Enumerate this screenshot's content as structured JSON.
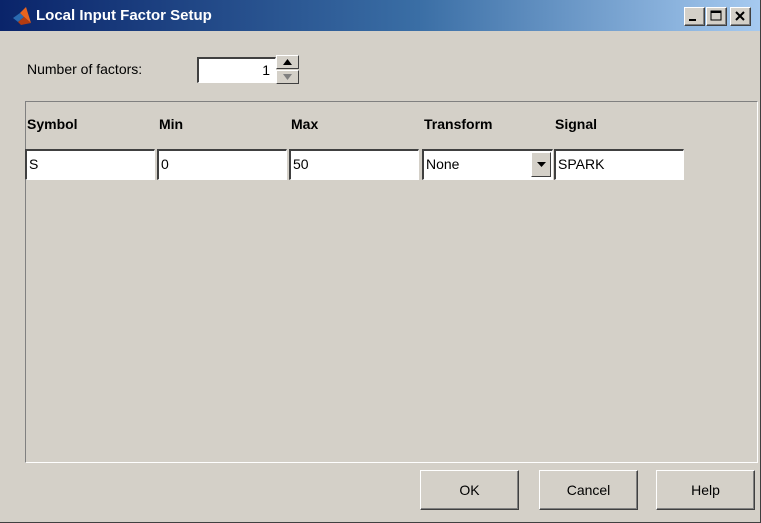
{
  "window": {
    "title": "Local Input Factor Setup",
    "app_icon": "matlab-logo-icon",
    "controls": [
      "minimize-icon",
      "maximize-icon",
      "close-icon"
    ]
  },
  "factors": {
    "label": "Number of factors:",
    "value": "1"
  },
  "table": {
    "columns": [
      "Symbol",
      "Min",
      "Max",
      "Transform",
      "Signal"
    ],
    "rows": [
      {
        "symbol": "S",
        "min": "0",
        "max": "50",
        "transform": "None",
        "signal": "SPARK"
      }
    ]
  },
  "buttons": {
    "ok": "OK",
    "cancel": "Cancel",
    "help": "Help"
  },
  "colors": {
    "title_gradient_start": "#0a246a",
    "title_gradient_end": "#a6caf0",
    "face": "#d4d0c8"
  }
}
